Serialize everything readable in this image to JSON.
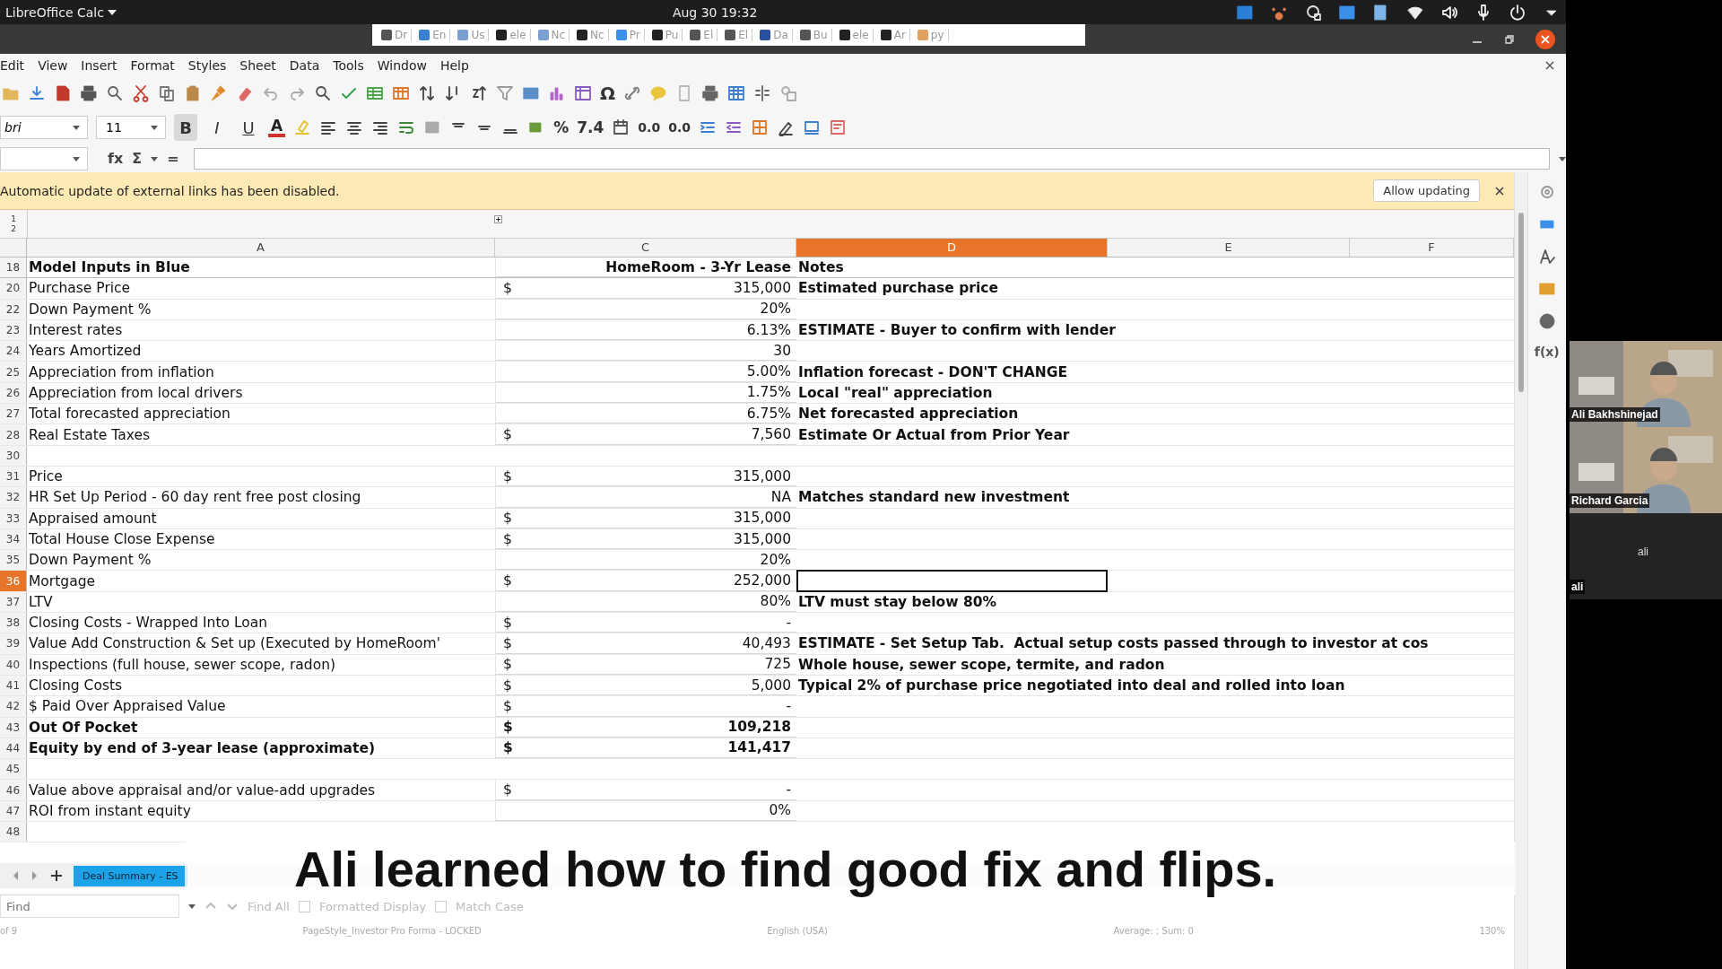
{
  "topbar": {
    "app": "LibreOffice Calc",
    "clock": "Aug 30  19:32"
  },
  "browser_tabs": [
    "Dr",
    "En",
    "Us",
    "ele",
    "Nc",
    "Nc",
    "Pr",
    "Pu",
    "El",
    "El",
    "Da",
    "Bu",
    "ele",
    "Ar",
    "py"
  ],
  "menu": [
    "Edit",
    "View",
    "Insert",
    "Format",
    "Styles",
    "Sheet",
    "Data",
    "Tools",
    "Window",
    "Help"
  ],
  "font_name": "bri",
  "font_size": "11",
  "format_buttons": [
    {
      "label": "B",
      "selected": true
    },
    {
      "label": "I",
      "selected": false
    },
    {
      "label": "U",
      "selected": false
    }
  ],
  "toolbar_text": {
    "special_character": "Ω",
    "font_color": "A",
    "percent": "%",
    "number": "7.4",
    "add_decimal": "0.0",
    "delete_decimal": "0.0"
  },
  "formula_bar": {
    "function_wizard": "fx",
    "sum": "Σ",
    "equals": "="
  },
  "infobar": {
    "message": "Automatic update of external links has been disabled.",
    "button": "Allow updating"
  },
  "outline_levels": [
    "1",
    "2"
  ],
  "columns": [
    {
      "label": "A",
      "selected": false
    },
    {
      "label": "C",
      "selected": false
    },
    {
      "label": "D",
      "selected": true
    },
    {
      "label": "E",
      "selected": false
    },
    {
      "label": "F",
      "selected": false
    }
  ],
  "rows": [
    {
      "num": "18",
      "kind": "header",
      "label": "Model Inputs in Blue",
      "value": "HomeRoom - 3-Yr Lease",
      "note": "Notes",
      "selected": false
    },
    {
      "num": "20",
      "label": "Purchase Price",
      "dollar": "$",
      "value": "315,000",
      "note": "Estimated purchase price",
      "selected": false
    },
    {
      "num": "22",
      "label": "Down Payment %",
      "value": "20%",
      "selected": false
    },
    {
      "num": "23",
      "label": "Interest rates",
      "value": "6.13%",
      "note": "ESTIMATE - Buyer to confirm with lender",
      "selected": false
    },
    {
      "num": "24",
      "label": "Years Amortized",
      "value": "30",
      "selected": false
    },
    {
      "num": "25",
      "label": "Appreciation from inflation",
      "value": "5.00%",
      "note": "Inflation forecast - DON'T CHANGE",
      "selected": false
    },
    {
      "num": "26",
      "label": "Appreciation from local drivers",
      "value": "1.75%",
      "note": "Local \"real\" appreciation",
      "selected": false
    },
    {
      "num": "27",
      "label": "Total forecasted appreciation",
      "value": "6.75%",
      "note": "Net forecasted appreciation",
      "selected": false
    },
    {
      "num": "28",
      "label": "Real Estate Taxes",
      "dollar": "$",
      "value": "7,560",
      "note": "Estimate Or Actual from Prior Year",
      "selected": false
    },
    {
      "num": "30",
      "selected": false
    },
    {
      "num": "31",
      "label": "Price",
      "dollar": "$",
      "value": "315,000",
      "selected": false
    },
    {
      "num": "32",
      "label": "HR Set Up Period - 60 day rent free post closing",
      "value": "NA",
      "note": "Matches standard new investment",
      "selected": false
    },
    {
      "num": "33",
      "label": "Appraised amount",
      "dollar": "$",
      "value": "315,000",
      "selected": false
    },
    {
      "num": "34",
      "label": "Total House Close Expense",
      "dollar": "$",
      "value": "315,000",
      "selected": false
    },
    {
      "num": "35",
      "label": "Down Payment %",
      "value": "20%",
      "selected": false
    },
    {
      "num": "36",
      "label": "Mortgage",
      "dollar": "$",
      "value": "252,000",
      "selected": true
    },
    {
      "num": "37",
      "label": "LTV",
      "value": "80%",
      "note": "LTV must stay below 80%",
      "selected": false
    },
    {
      "num": "38",
      "label": "Closing Costs - Wrapped Into Loan",
      "dollar": "$",
      "value": "-",
      "selected": false
    },
    {
      "num": "39",
      "label": "Value Add Construction & Set up (Executed by HomeRoom'",
      "dollar": "$",
      "value": "40,493",
      "note": "ESTIMATE - Set Setup Tab.  Actual setup costs passed through to investor at cos",
      "selected": false
    },
    {
      "num": "40",
      "label": "Inspections (full house, sewer scope, radon)",
      "dollar": "$",
      "value": "725",
      "note": "Whole house, sewer scope, termite, and radon",
      "selected": false
    },
    {
      "num": "41",
      "label": "Closing Costs",
      "dollar": "$",
      "value": "5,000",
      "note": "Typical 2% of purchase price negotiated into deal and rolled into loan",
      "selected": false
    },
    {
      "num": "42",
      "label": "$ Paid Over Appraised Value",
      "dollar": "$",
      "value": "-",
      "selected": false
    },
    {
      "num": "43",
      "kind": "total",
      "label": "Out Of Pocket",
      "dollar": "$",
      "value": "109,218",
      "selected": false
    },
    {
      "num": "44",
      "kind": "total",
      "label": "Equity by end of 3-year lease (approximate)",
      "dollar": "$",
      "value": "141,417",
      "selected": false
    },
    {
      "num": "45",
      "selected": false
    },
    {
      "num": "46",
      "label": "Value above appraisal and/or value-add upgrades",
      "dollar": "$",
      "value": "-",
      "selected": false
    },
    {
      "num": "47",
      "label": "ROI from instant equity",
      "value": "0%",
      "selected": false
    },
    {
      "num": "48",
      "selected": false
    }
  ],
  "sidebar_functions": "f(x)",
  "sheet_tabs": [
    {
      "label": "Deal Summary - ES",
      "selected": true
    }
  ],
  "find_bar": {
    "placeholder": "Find",
    "find_all": "Find All",
    "options": [
      {
        "label": "Formatted Display",
        "checked": false
      },
      {
        "label": "Match Case",
        "checked": false
      }
    ]
  },
  "status_bar": [
    "of 9",
    "PageStyle_Investor Pro Forma - LOCKED",
    "English (USA)",
    "Average: ; Sum: 0",
    "130%"
  ],
  "participants": [
    {
      "kind": "video",
      "name": "Ali Bakhshinejad"
    },
    {
      "kind": "video",
      "name": "Richard Garcia"
    },
    {
      "kind": "avatar",
      "name": "ali",
      "display": "ali"
    }
  ],
  "caption": "Ali learned how to find good fix and flips."
}
